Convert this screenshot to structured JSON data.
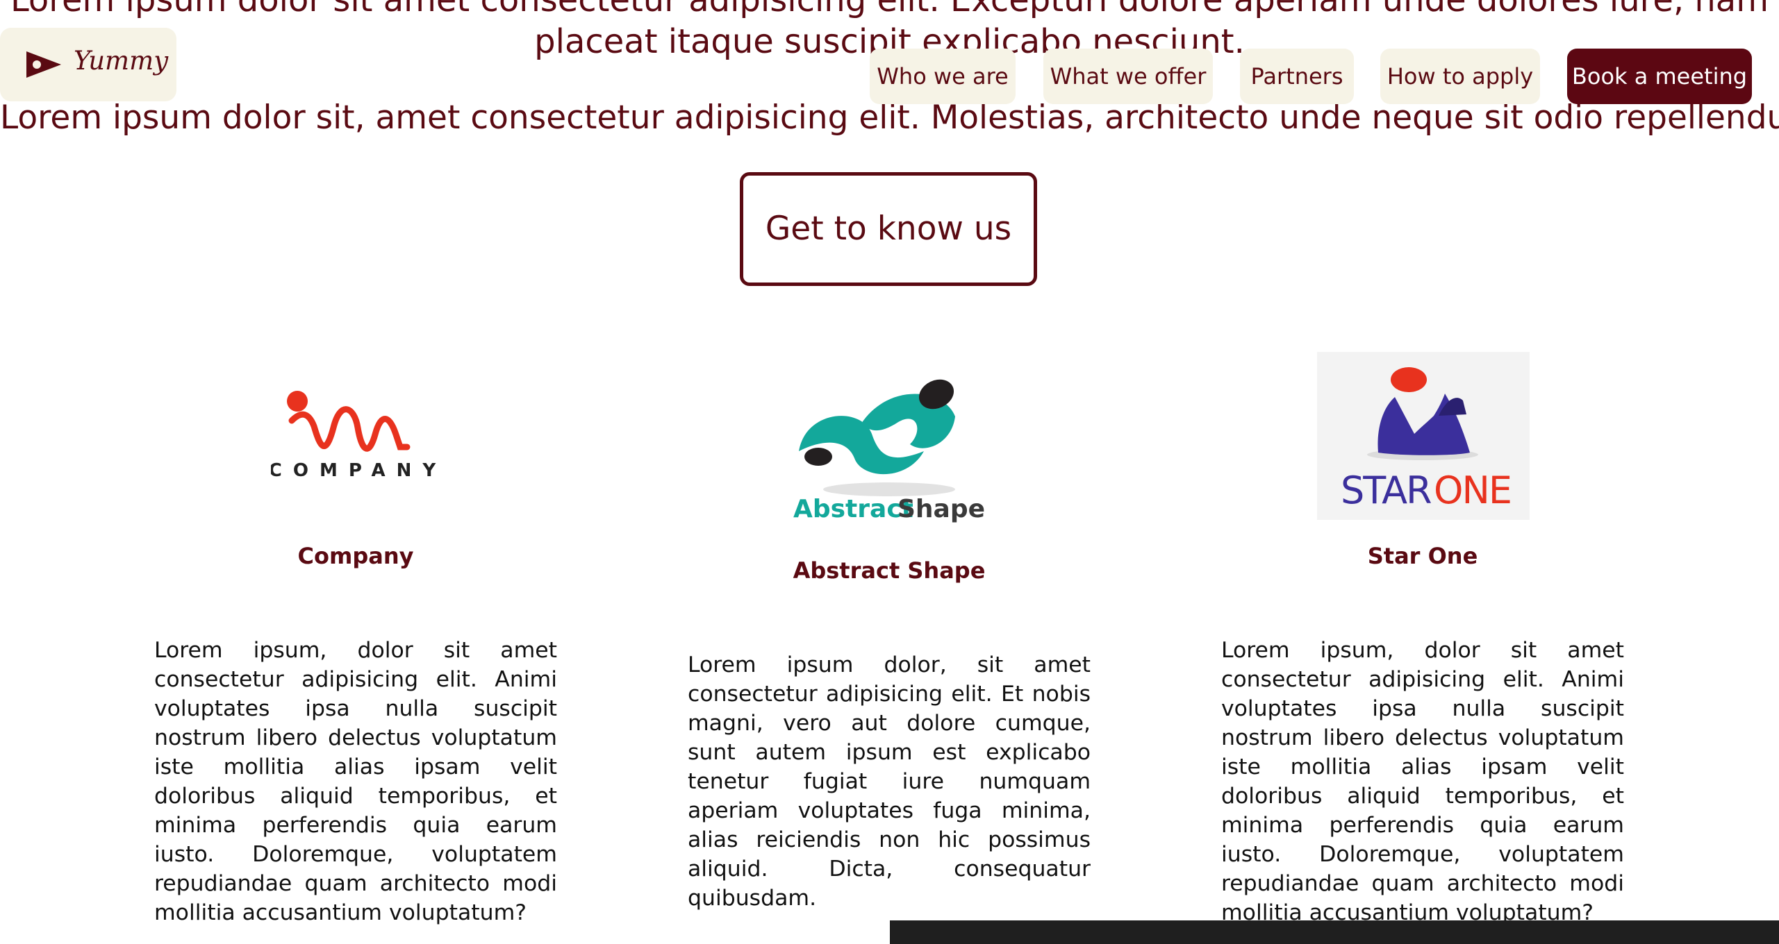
{
  "hero": {
    "line1": "Lorem ipsum dolor sit amet consectetur adipisicing elit. Excepturi dolore aperiam unde dolores iure, nam",
    "line2": "placeat itaque suscipit explicabo nesciunt.",
    "line3": "Lorem ipsum dolor sit, amet consectetur adipisicing elit. Molestias, architecto unde neque sit odio repellendus."
  },
  "brand": {
    "name": "Yummy",
    "icon": "flag-play-icon"
  },
  "nav": {
    "items": [
      {
        "label": "Who we are"
      },
      {
        "label": "What we offer"
      },
      {
        "label": "Partners"
      },
      {
        "label": "How to apply"
      }
    ],
    "cta": "Book a meeting"
  },
  "cta_button": "Get to know us",
  "partners": [
    {
      "name": "Company",
      "logo_text": "COMPANY",
      "text": "Lorem ipsum, dolor sit amet consectetur adipisicing elit. Animi voluptates ipsa nulla suscipit nostrum libero delectus voluptatum iste mollitia alias ipsam velit doloribus aliquid temporibus, et minima perferendis quia earum iusto. Doloremque, voluptatem repudiandae quam architecto modi mollitia accusantium voluptatum?"
    },
    {
      "name": "Abstract Shape",
      "logo_text_a": "Abstract",
      "logo_text_b": "Shape",
      "text": "Lorem ipsum dolor, sit amet consectetur adipisicing elit. Et nobis magni, vero aut dolore cumque, sunt autem ipsum est explicabo tenetur fugiat iure numquam aperiam voluptates fuga minima, alias reiciendis non hic possimus aliquid. Dicta, consequatur quibusdam."
    },
    {
      "name": "Star One",
      "logo_text_a": "STAR",
      "logo_text_b": "ONE",
      "text": "Lorem ipsum, dolor sit amet consectetur adipisicing elit. Animi voluptates ipsa nulla suscipit nostrum libero delectus voluptatum iste mollitia alias ipsam velit doloribus aliquid temporibus, et minima perferendis quia earum iusto. Doloremque, voluptatem repudiandae quam architecto modi mollitia accusantium voluptatum?"
    }
  ],
  "colors": {
    "brand": "#5a0a12",
    "cta_bg": "#5c0712",
    "pill_bg": "#f6f3e6",
    "abstract_teal": "#13a89b",
    "company_red": "#e8321e",
    "starone_blue": "#3b2f9c",
    "starone_red": "#e8321e"
  }
}
